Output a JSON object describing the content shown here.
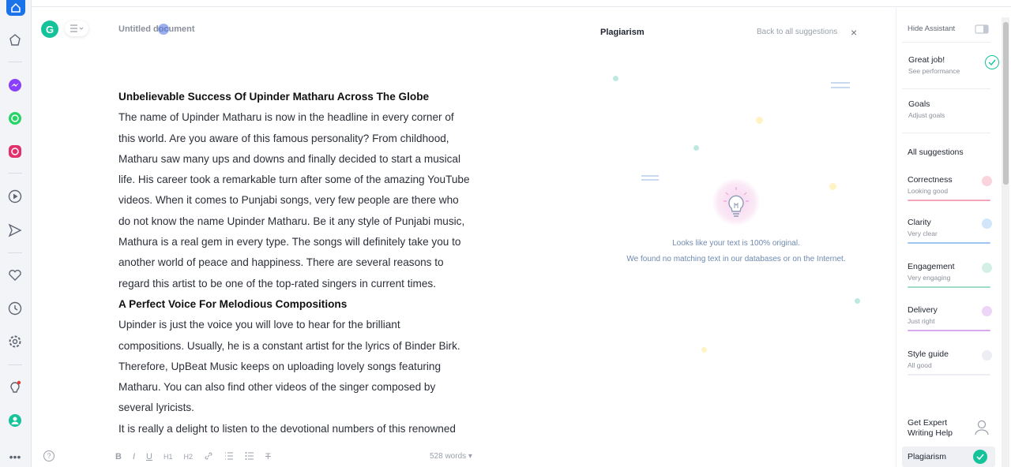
{
  "app": {
    "doc_title": "Untitled document",
    "logo_letter": "G"
  },
  "dock": {
    "icons": [
      "home-icon",
      "star-icon",
      "messenger-icon",
      "whatsapp-icon",
      "instagram-icon",
      "play-icon",
      "send-icon",
      "heart-icon",
      "clock-icon",
      "settings-icon",
      "lightbulb-icon",
      "profile-icon",
      "more-icon"
    ]
  },
  "editor": {
    "paragraphs": [
      {
        "type": "heading",
        "text": "Unbelievable Success Of Upinder Matharu Across The Globe"
      },
      {
        "type": "text",
        "lines": [
          "The name of Upinder Matharu is now in the headline in every corner of",
          "this world. Are you aware of this famous personality? From childhood,",
          "Matharu saw many ups and downs and finally decided to start a musical",
          "life. His career took a remarkable turn after some of the amazing YouTube",
          "videos. When it comes to Punjabi songs, very few people are there who",
          "do not know the name Upinder Matharu. Be it any style of Punjabi music,",
          "Mathura is a real gem in every type. The songs will definitely take you to",
          "another world of peace and happiness. There are several reasons to",
          "regard this artist to be one of the top-rated singers in current times."
        ]
      },
      {
        "type": "heading",
        "text": "A Perfect Voice For Melodious Compositions"
      },
      {
        "type": "text",
        "lines": [
          "Upinder is just the voice you will love to hear for the brilliant",
          "compositions. Usually, he is a constant artist for the lyrics of Binder Birk.",
          "Therefore, UpBeat Music keeps on uploading lovely songs featuring",
          "Matharu. You can also find other videos of the singer composed by",
          "several lyricists.",
          "It is really a delight to listen to the devotional numbers of this renowned"
        ]
      }
    ],
    "toolbar": {
      "bold": "B",
      "italic": "I",
      "underline": "U",
      "h1": "H1",
      "h2": "H2",
      "clear": "T"
    },
    "word_count": "528 words"
  },
  "plagiarism": {
    "title": "Plagiarism",
    "back_link": "Back to all suggestions",
    "close": "×",
    "message1": "Looks like your text is 100% original.",
    "message2": "We found no matching text in our databases or on the Internet."
  },
  "sidebar": {
    "hide_assistant": "Hide Assistant",
    "great_job": {
      "title": "Great job!",
      "sub": "See performance"
    },
    "goals": {
      "title": "Goals",
      "sub": "Adjust goals"
    },
    "all_suggestions": "All suggestions",
    "categories": [
      {
        "title": "Correctness",
        "sub": "Looking good",
        "color": "#f4a6b8"
      },
      {
        "title": "Clarity",
        "sub": "Very clear",
        "color": "#9cc6f0"
      },
      {
        "title": "Engagement",
        "sub": "Very engaging",
        "color": "#9fdcc6"
      },
      {
        "title": "Delivery",
        "sub": "Just right",
        "color": "#d7a9ef"
      },
      {
        "title": "Style guide",
        "sub": "All good",
        "color": "#cfd3e0"
      }
    ],
    "expert": {
      "line1": "Get Expert",
      "line2": "Writing Help"
    },
    "plagiarism": "Plagiarism"
  },
  "colors": {
    "brand": "#15c39a",
    "accent_blue": "#1a73e8"
  }
}
